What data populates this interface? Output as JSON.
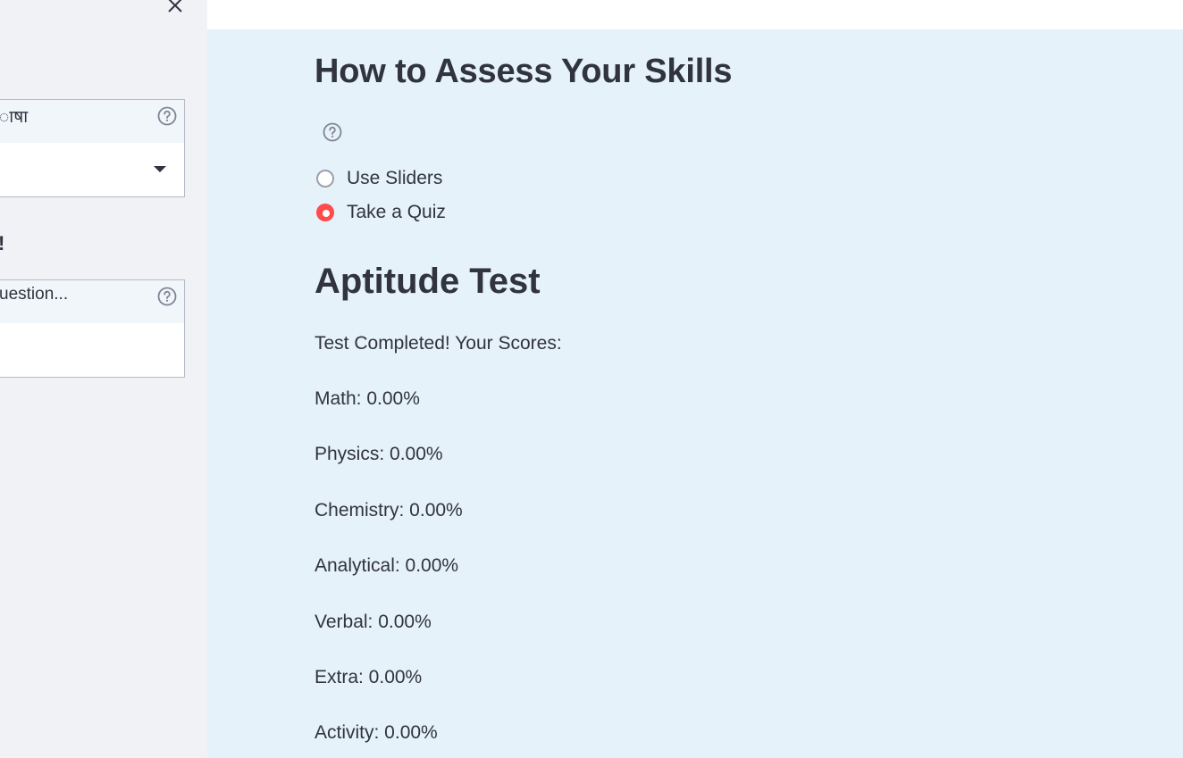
{
  "sidebar": {
    "language_select": {
      "label": "भाषा",
      "visible_label_fragment": "ाषा",
      "value": ""
    },
    "heading_fragment": "!",
    "question_input": {
      "label_fragment": "uestion..."
    }
  },
  "main": {
    "assess_title": "How to Assess Your Skills",
    "assess_options": [
      {
        "label": "Use Sliders",
        "selected": false
      },
      {
        "label": "Take a Quiz",
        "selected": true
      }
    ],
    "test_title": "Aptitude Test",
    "completed_text": "Test Completed! Your Scores:",
    "scores": [
      "Math: 0.00%",
      "Physics: 0.00%",
      "Chemistry: 0.00%",
      "Analytical: 0.00%",
      "Verbal: 0.00%",
      "Extra: 0.00%",
      "Activity: 0.00%"
    ]
  },
  "icons": {
    "close": "close-icon",
    "help": "question-circle-icon",
    "dropdown": "caret-down-icon"
  },
  "colors": {
    "accent": "#ff4b4b",
    "sidebar_bg": "#f0f2f6",
    "main_bg": "#e5f2fa",
    "text": "#31333f"
  }
}
